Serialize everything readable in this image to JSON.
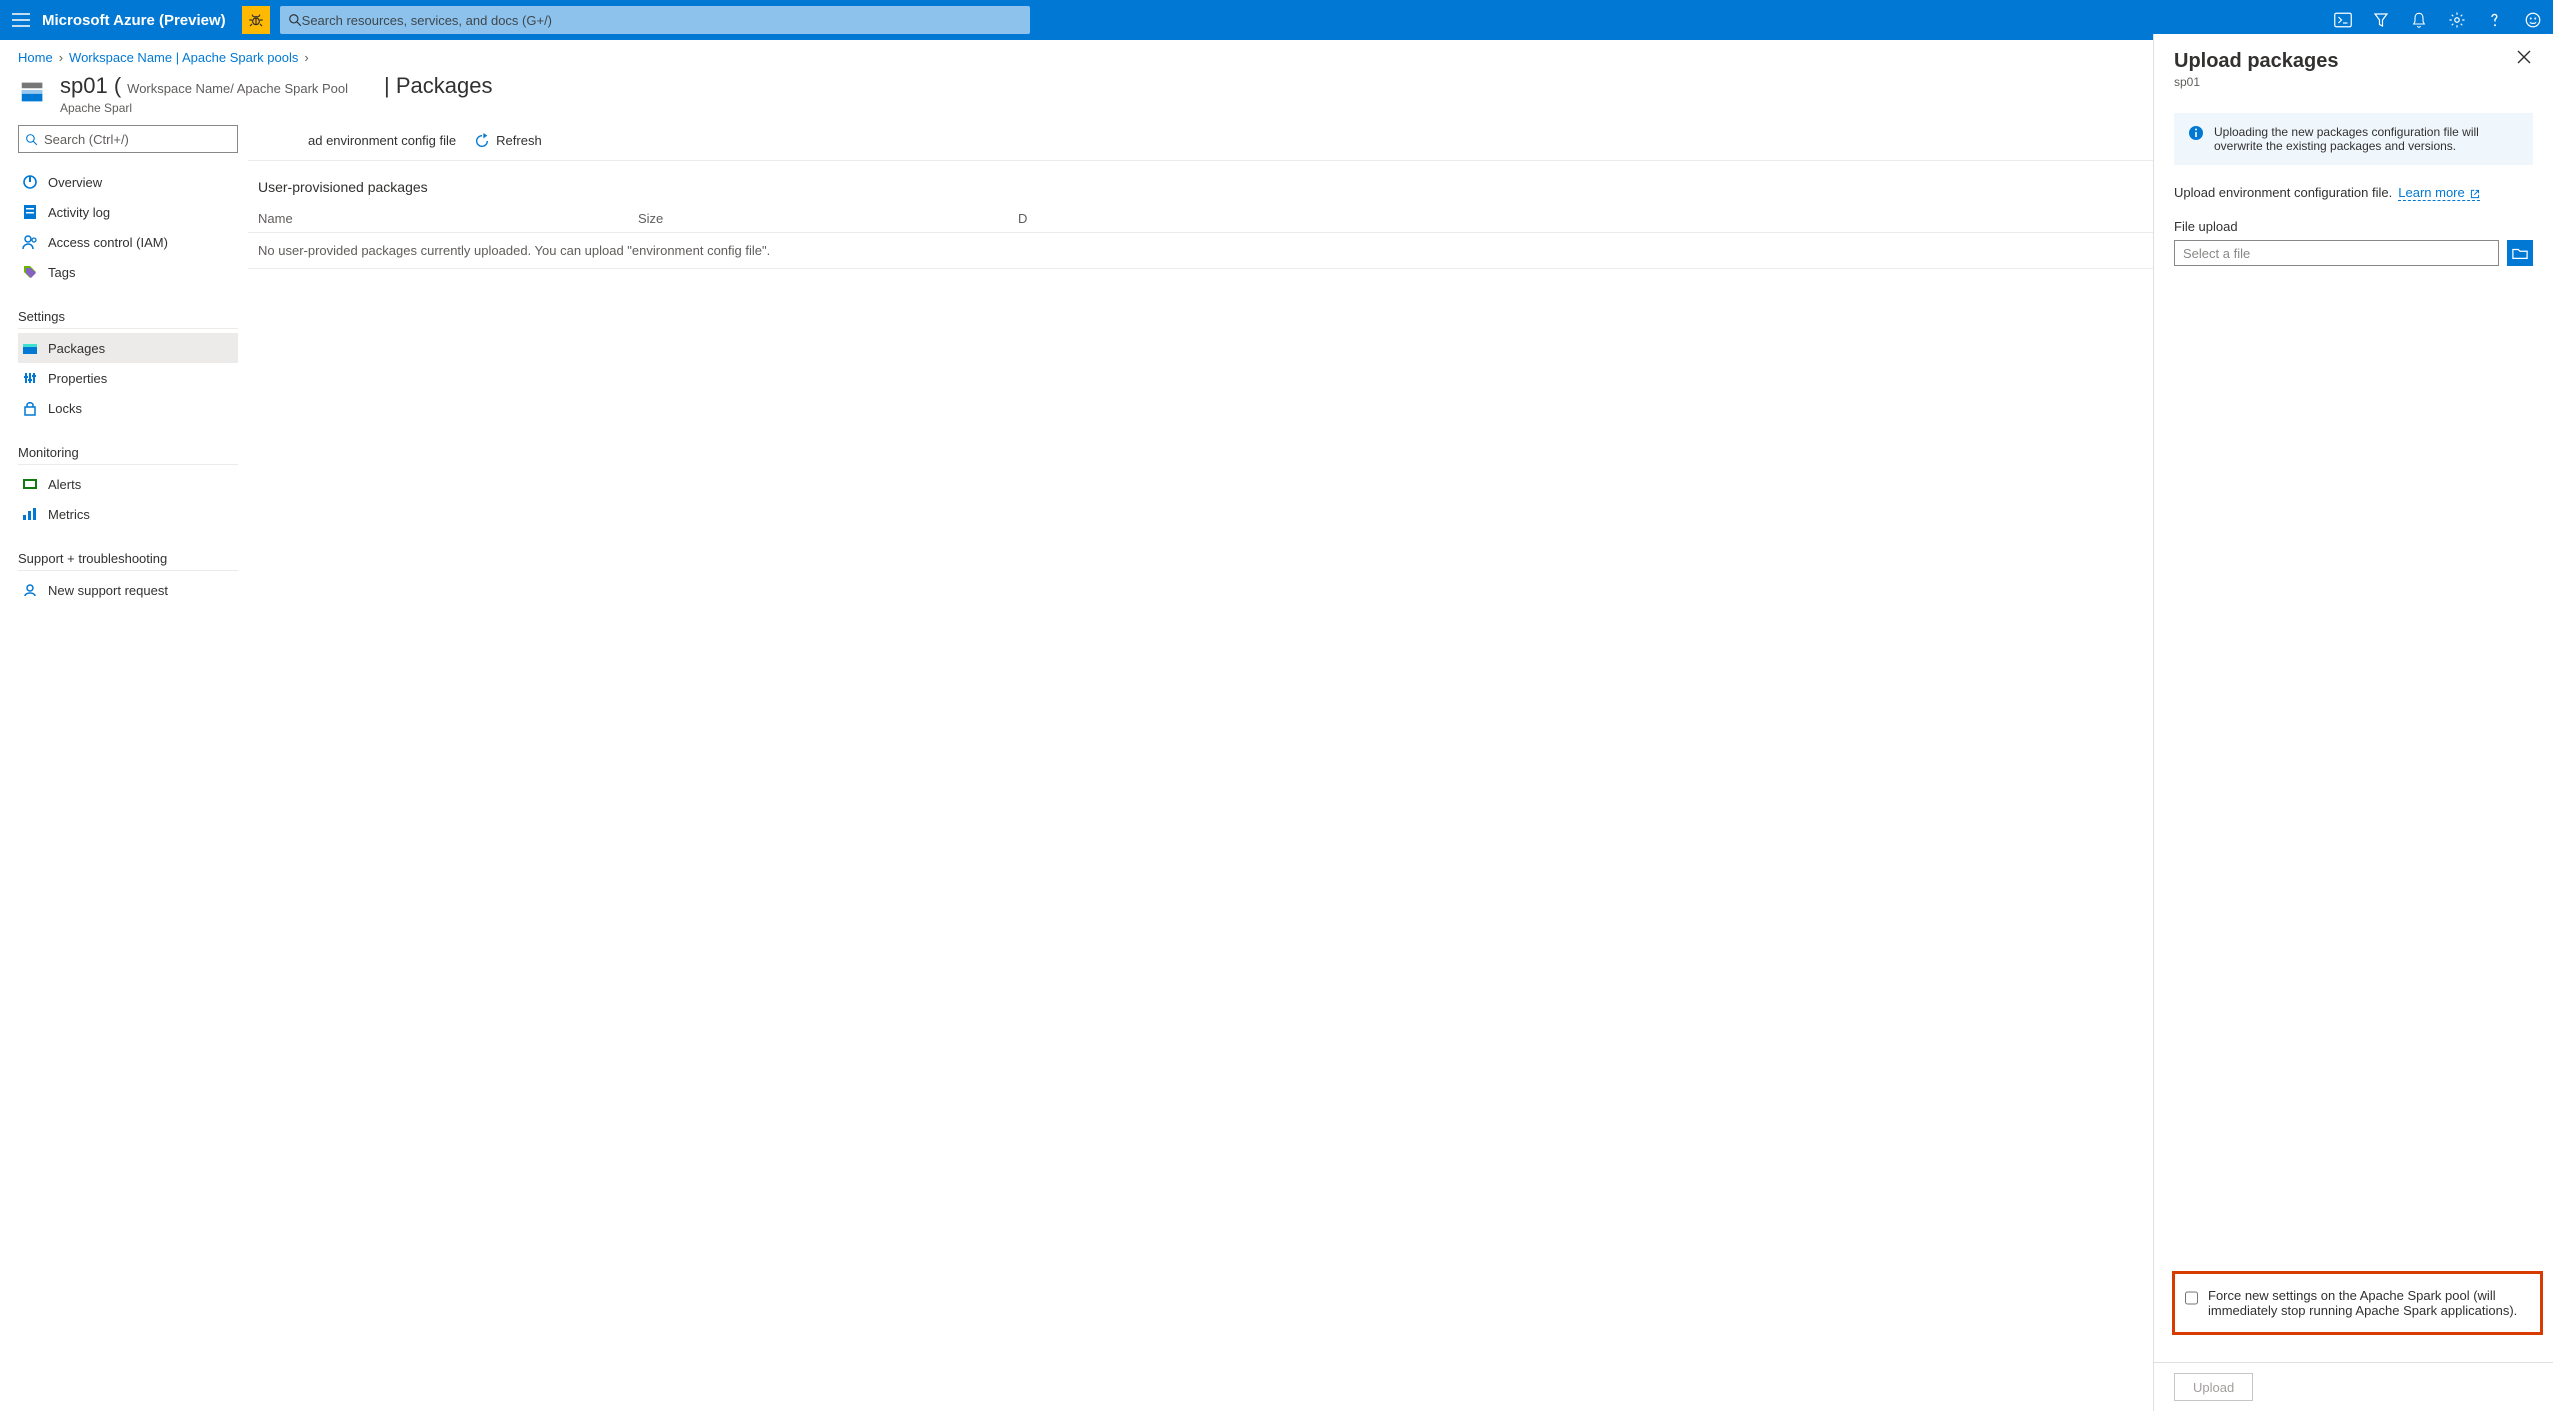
{
  "header": {
    "brand": "Microsoft Azure (Preview)",
    "search_placeholder": "Search resources, services, and docs (G+/)"
  },
  "breadcrumbs": {
    "home": "Home",
    "workspace": "Workspace Name | Apache Spark pools"
  },
  "resource": {
    "name_open": "sp01 (",
    "path": "Workspace Name/ Apache Spark Pool",
    "subtype": "Apache Sparl",
    "blade_title": "| Packages"
  },
  "nav": {
    "search_placeholder": "Search (Ctrl+/)",
    "general": {
      "overview": "Overview",
      "activity_log": "Activity log",
      "iam": "Access control (IAM)",
      "tags": "Tags"
    },
    "settings_label": "Settings",
    "settings": {
      "packages": "Packages",
      "properties": "Properties",
      "locks": "Locks"
    },
    "monitoring_label": "Monitoring",
    "monitoring": {
      "alerts": "Alerts",
      "metrics": "Metrics"
    },
    "support_label": "Support + troubleshooting",
    "support": {
      "new_request": "New support request"
    }
  },
  "toolbar": {
    "upload_config_partial": "ad environment config file",
    "refresh": "Refresh"
  },
  "packages": {
    "section_title": "User-provisioned packages",
    "col_name": "Name",
    "col_size": "Size",
    "col_date_partial": "D",
    "empty": "No user-provided packages currently uploaded. You can upload \"environment config file\"."
  },
  "panel": {
    "title": "Upload packages",
    "subtitle": "sp01",
    "info": "Uploading the new packages configuration file will overwrite the existing packages and versions.",
    "desc": "Upload environment configuration file.",
    "learn_more": "Learn more",
    "file_label": "File upload",
    "file_placeholder": "Select a file",
    "force_label": "Force new settings on the Apache Spark pool (will immediately stop running Apache Spark applications).",
    "upload_btn": "Upload"
  }
}
